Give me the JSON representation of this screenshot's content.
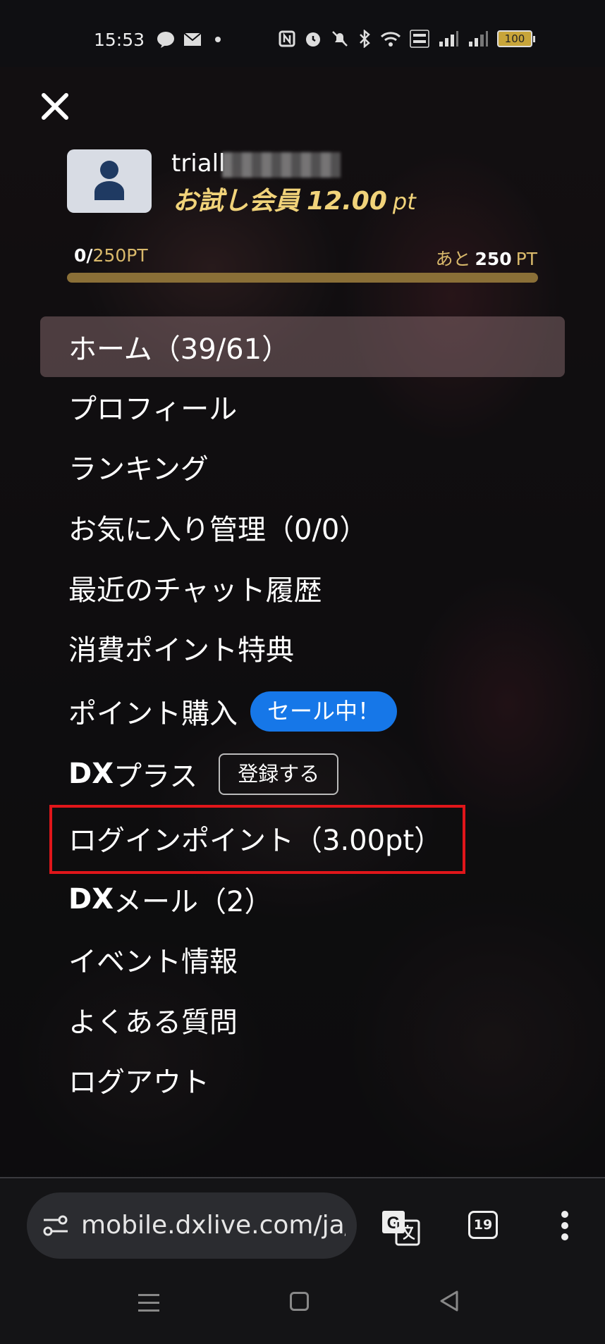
{
  "status_bar": {
    "time": "15:53",
    "notification_icons": [
      "line-icon",
      "mail-icon",
      "dot-icon"
    ],
    "system_icons": [
      "nfc-icon",
      "alarm-icon",
      "mute-icon",
      "bluetooth-icon",
      "wifi-icon",
      "volte-icon",
      "signal-icon",
      "signal-icon"
    ],
    "battery": "100"
  },
  "drawer": {
    "close_icon": "close-icon",
    "user": {
      "avatar_icon": "person-icon",
      "username": "triall",
      "membership": "お試し会員",
      "points": "12.00",
      "points_unit": "pt"
    },
    "progress": {
      "current": "0/",
      "total": "250PT",
      "remaining_prefix": "あと",
      "remaining": "250",
      "remaining_unit": "PT",
      "fraction": 0
    },
    "menu": {
      "home": "ホーム（39/61）",
      "profile": "プロフィール",
      "ranking": "ランキング",
      "favorites": "お気に入り管理（0/0）",
      "chat_history": "最近のチャット履歴",
      "point_benefits": "消費ポイント特典",
      "buy_points": "ポイント購入",
      "sale_badge": "セール中！",
      "dx_plus_bold": "DX",
      "dx_plus_rest": "プラス",
      "register_button": "登録する",
      "login_points": "ログインポイント（3.00pt）",
      "dx_mail_bold": "DX",
      "dx_mail_rest": "メール（2）",
      "events": "イベント情報",
      "faq": "よくある質問",
      "logout": "ログアウト"
    }
  },
  "browser": {
    "url": "mobile.dxlive.com/ja/h",
    "tab_count": "19",
    "icons": [
      "site-settings-icon",
      "translate-icon",
      "tabs-icon",
      "more-icon"
    ]
  },
  "nav_bar": {
    "icons": [
      "recents-icon",
      "home-icon",
      "back-icon"
    ]
  },
  "colors": {
    "gold": "#f1d37a",
    "sale_blue": "#1677e8",
    "highlight_red": "#e0161a"
  }
}
